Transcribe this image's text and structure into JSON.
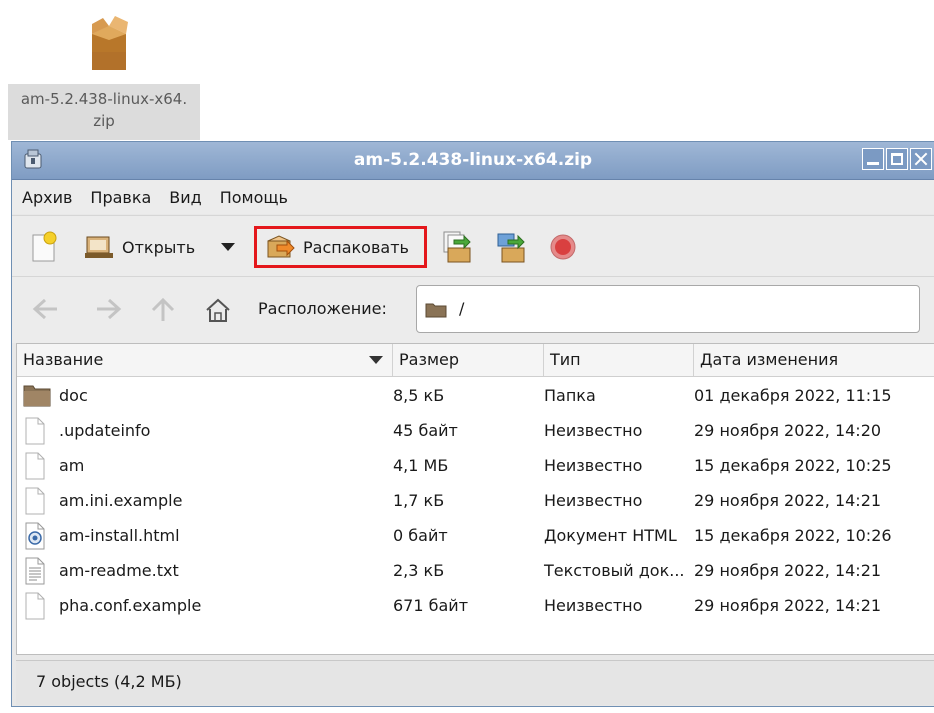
{
  "desktop": {
    "icon_label_line1": "am-5.2.438-linux-x64.",
    "icon_label_line2": "zip"
  },
  "window": {
    "title": "am-5.2.438-linux-x64.zip"
  },
  "menubar": {
    "items": [
      "Архив",
      "Правка",
      "Вид",
      "Помощь"
    ]
  },
  "toolbar": {
    "open_label": "Открыть",
    "extract_label": "Распаковать",
    "highlight_color": "#e4171b"
  },
  "location": {
    "label": "Расположение:",
    "path": "/"
  },
  "file_list": {
    "columns": [
      "Название",
      "Размер",
      "Тип",
      "Дата изменения"
    ],
    "rows": [
      {
        "icon": "folder-icon",
        "name": "doc",
        "size": "8,5 кБ",
        "type": "Папка",
        "date": "01 декабря 2022, 11:15"
      },
      {
        "icon": "file-icon",
        "name": ".updateinfo",
        "size": "45 байт",
        "type": "Неизвестно",
        "date": "29 ноября 2022, 14:20"
      },
      {
        "icon": "file-icon",
        "name": "am",
        "size": "4,1 МБ",
        "type": "Неизвестно",
        "date": "15 декабря 2022, 10:25"
      },
      {
        "icon": "file-icon",
        "name": "am.ini.example",
        "size": "1,7 кБ",
        "type": "Неизвестно",
        "date": "29 ноября 2022, 14:21"
      },
      {
        "icon": "html-file-icon",
        "name": "am-install.html",
        "size": "0 байт",
        "type": "Документ HTML",
        "date": "15 декабря 2022, 10:26"
      },
      {
        "icon": "text-file-icon",
        "name": "am-readme.txt",
        "size": "2,3 кБ",
        "type": "Текстовый док...",
        "date": "29 ноября 2022, 14:21"
      },
      {
        "icon": "file-icon",
        "name": "pha.conf.example",
        "size": "671 байт",
        "type": "Неизвестно",
        "date": "29 ноября 2022, 14:21"
      }
    ]
  },
  "status": {
    "text": "7 objects (4,2 МБ)"
  }
}
